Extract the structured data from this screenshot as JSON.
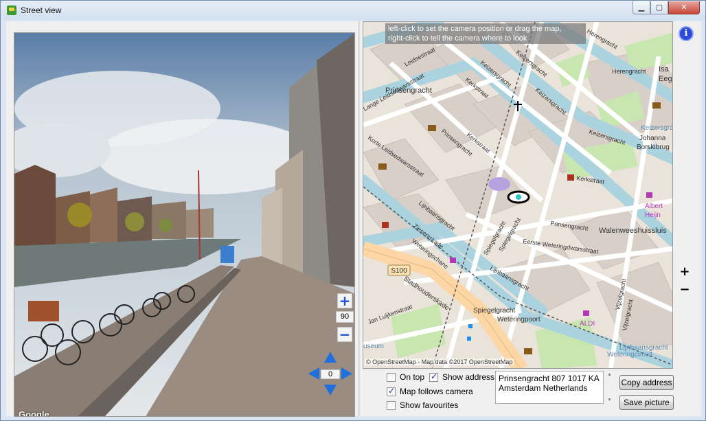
{
  "window": {
    "title": "Street view"
  },
  "street_view": {
    "zoom_in_label": "+",
    "zoom_level": "90",
    "zoom_out_label": "−",
    "heading": "0",
    "logo_text": "Google"
  },
  "map": {
    "hint": "left-click to set the camera position or drag the map,\nright-click to tell the camera where to look",
    "credit": "© OpenStreetMap - Map data ©2017 OpenStreetMap",
    "zoom_in_label": "+",
    "zoom_out_label": "−",
    "info_label": "i",
    "labels": {
      "prinsengracht_1": "Prinsengracht",
      "prinsengracht_2": "Prinsengracht",
      "prinsengracht_3": "Prinsengracht",
      "leidsestraat": "Leidsestraat",
      "kerkstraat_1": "Kerkstraat",
      "kerkstraat_2": "Kerkstraat",
      "keizersgracht_1": "Keizersgracht",
      "keizersgracht_2": "Keizersgracht",
      "keizersgracht_3": "Keizersgracht",
      "keizersgracht_4": "Keizersgracht",
      "keizersgracht_5": "Keizersgracht",
      "herengracht_1": "Herengracht",
      "herengracht_2": "Herengracht",
      "lange_leidsedwarsstraat": "Lange Leidsedwarsstraat",
      "korte_leidsedwarsstraat": "Korte Leidsedwarsstraat",
      "lijnbaansgracht_1": "Lijnbaansgracht",
      "lijnbaansgracht_2": "Lijnbaansgracht",
      "zieseniskade": "Zieseniskade",
      "weteringschans": "Weteringschans",
      "spiegelgracht_1": "Spiegelgracht",
      "spiegelgracht_2": "Spiegelgracht",
      "eerste_weteringdwarsstraat": "Eerste Weteringdwarsstraat",
      "walenweeshuissluis": "Walenweeshuissluis",
      "vijzelgracht_1": "Vijzelgracht",
      "vijzelgracht_2": "Vijzelgracht",
      "s100": "S100",
      "stadhouderskade": "Stadhouderskade",
      "jan_luijkenstraat": "Jan Luijkenstraat",
      "weteringpoort": "Weteringpoort",
      "aldi": "ALDI",
      "albert_heijn": "Albert\nHeijn",
      "johanna_borskibru": "Johanna\nBorskibrug",
      "isa": "Isa",
      "eeghe": "Eeghe",
      "lijnbaansgracht_3": "Lijnbaansgracht",
      "weteringcircuit": "Weteringcircuit",
      "museum": "useum",
      "heir": "Heir"
    }
  },
  "options": {
    "on_top_label": "On top",
    "on_top_checked": false,
    "show_address_label": "Show address",
    "show_address_checked": true,
    "map_follows_label": "Map follows camera",
    "map_follows_checked": true,
    "show_favourites_label": "Show favourites",
    "show_favourites_checked": false
  },
  "address": {
    "text": "Prinsengracht 807 1017 KA\nAmsterdam Netherlands"
  },
  "buttons": {
    "copy_address": "Copy address",
    "save_picture": "Save picture"
  }
}
